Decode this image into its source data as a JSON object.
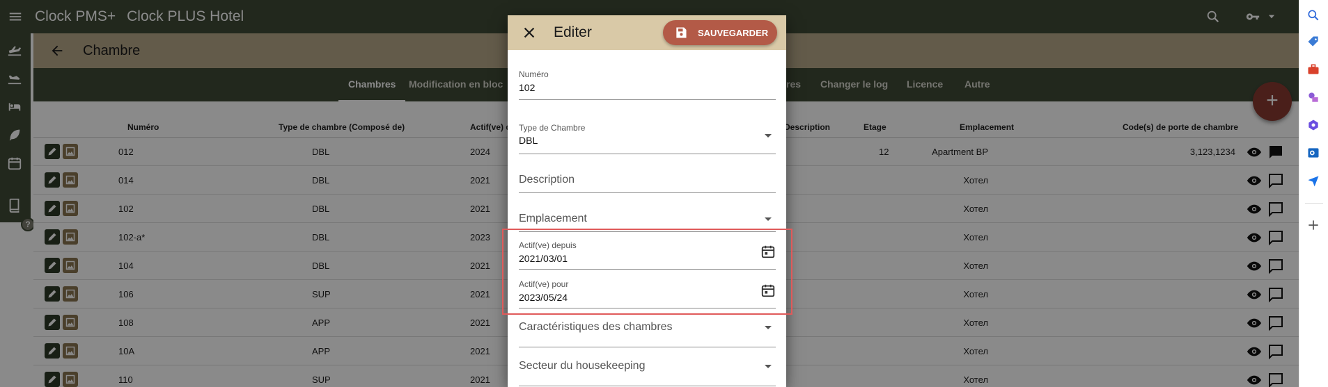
{
  "app": {
    "brand": "Clock PMS+",
    "hotel": "Clock PLUS Hotel"
  },
  "page": {
    "title": "Chambre"
  },
  "tabs": [
    {
      "label": "Chambres",
      "active": true
    },
    {
      "label": "Modification en bloc",
      "active": false
    },
    {
      "label": "res",
      "active": false
    },
    {
      "label": "Changer le log",
      "active": false
    },
    {
      "label": "Licence",
      "active": false
    },
    {
      "label": "Autre",
      "active": false
    }
  ],
  "table": {
    "headers": {
      "numero": "Numéro",
      "type": "Type de chambre (Composé de)",
      "actif": "Actif(ve) d",
      "description": "Description",
      "etage": "Etage",
      "emplacement": "Emplacement",
      "codes": "Code(s) de porte de chambre"
    },
    "rows": [
      {
        "numero": "012",
        "type": "DBL",
        "actif": "2024",
        "etage": "12",
        "emplacement": "Apartment BP",
        "codes": "3,123,1234"
      },
      {
        "numero": "014",
        "type": "DBL",
        "actif": "2021",
        "etage": "",
        "emplacement": "Хотел",
        "codes": ""
      },
      {
        "numero": "102",
        "type": "DBL",
        "actif": "2021",
        "etage": "",
        "emplacement": "Хотел",
        "codes": ""
      },
      {
        "numero": "102-a*",
        "type": "DBL",
        "actif": "2023",
        "etage": "",
        "emplacement": "Хотел",
        "codes": ""
      },
      {
        "numero": "104",
        "type": "DBL",
        "actif": "2021",
        "etage": "",
        "emplacement": "Хотел",
        "codes": ""
      },
      {
        "numero": "106",
        "type": "SUP",
        "actif": "2021",
        "etage": "",
        "emplacement": "Хотел",
        "codes": ""
      },
      {
        "numero": "108",
        "type": "APP",
        "actif": "2021",
        "etage": "",
        "emplacement": "Хотел",
        "codes": ""
      },
      {
        "numero": "10A",
        "type": "APP",
        "actif": "2021",
        "etage": "",
        "emplacement": "Хотел",
        "codes": ""
      },
      {
        "numero": "110",
        "type": "SUP",
        "actif": "2021",
        "etage": "",
        "emplacement": "Хотел",
        "codes": ""
      }
    ]
  },
  "dialog": {
    "title": "Editer",
    "save_label": "SAUVEGARDER",
    "numero": {
      "label": "Numéro",
      "value": "102"
    },
    "type": {
      "label": "Type de Chambre",
      "value": "DBL"
    },
    "description": {
      "placeholder": "Description"
    },
    "emplacement": {
      "placeholder": "Emplacement"
    },
    "actif_depuis": {
      "label": "Actif(ve) depuis",
      "value": "2021/03/01"
    },
    "actif_pour": {
      "label": "Actif(ve) pour",
      "value": "2023/05/24"
    },
    "caracteristiques": {
      "placeholder": "Caractéristiques des chambres"
    },
    "secteur": {
      "placeholder": "Secteur du housekeeping"
    }
  },
  "help_label": "?",
  "fab_label": "+",
  "colors": {
    "header": "#3f4a37",
    "subheader": "#b8a88a",
    "dialog_header": "#d9c9a7",
    "save": "#b35a47",
    "fab": "#8a3a30",
    "highlight": "#e05a5a"
  }
}
